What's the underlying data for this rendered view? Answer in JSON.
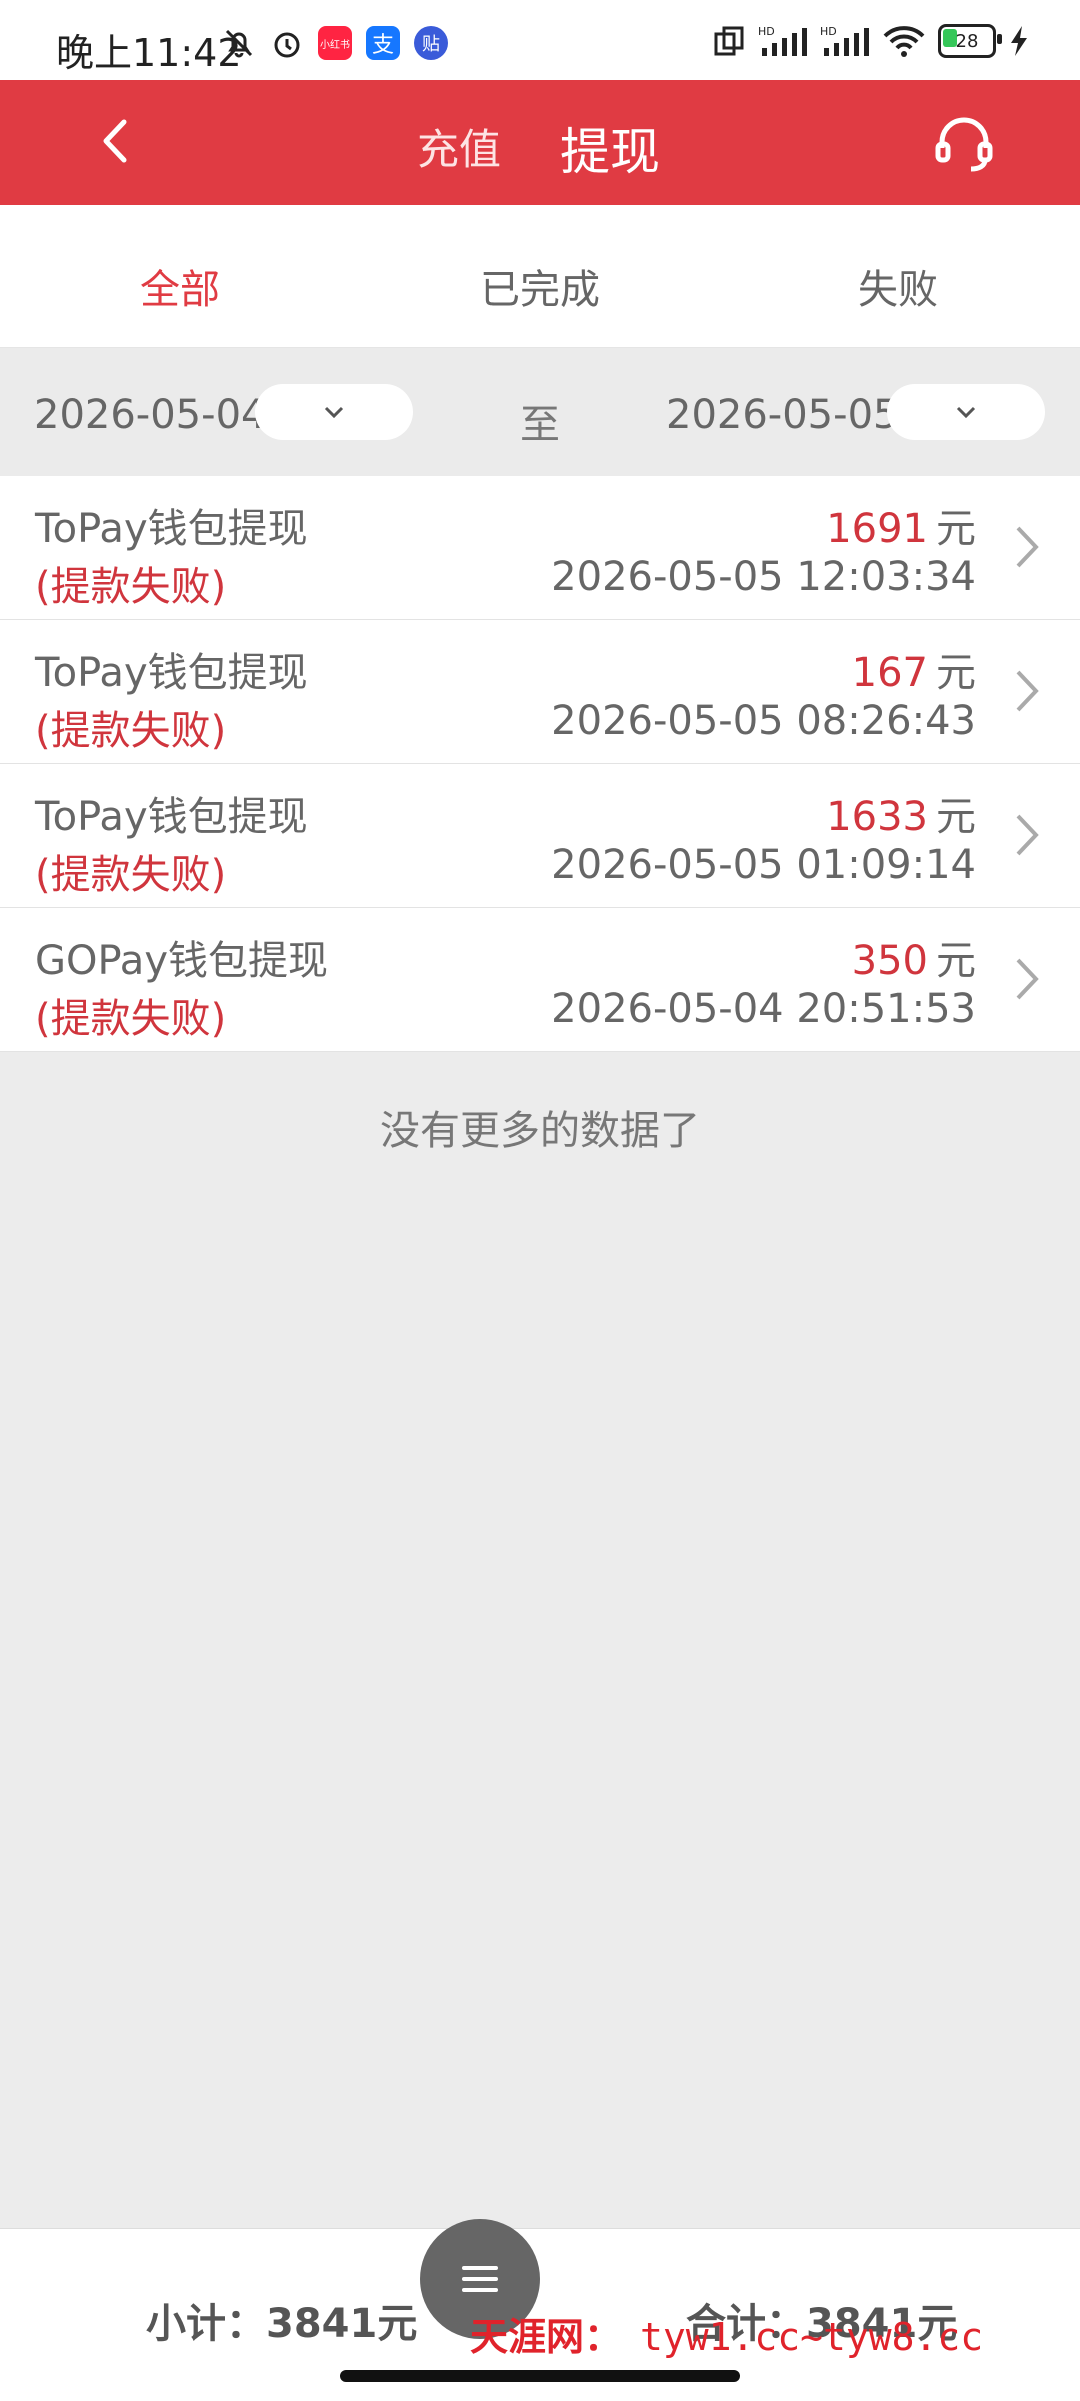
{
  "status_bar": {
    "time": "晚上11:42",
    "battery": "28",
    "app_badges": [
      {
        "label": "小红书",
        "color": "#ff2442"
      },
      {
        "label": "支",
        "color": "#1677ff"
      },
      {
        "label": "贴",
        "color": "#3a5bd9"
      }
    ]
  },
  "header": {
    "tab_recharge": "充值",
    "tab_withdraw": "提现"
  },
  "filter_tabs": [
    {
      "label": "全部",
      "active": true
    },
    {
      "label": "已完成",
      "active": false
    },
    {
      "label": "失败",
      "active": false
    }
  ],
  "date_filter": {
    "start": "2026-05-04",
    "separator": "至",
    "end": "2026-05-05"
  },
  "records": [
    {
      "title": "ToPay钱包提现",
      "status": "(提款失败)",
      "amount": "1691",
      "unit": "元",
      "time": "2026-05-05 12:03:34"
    },
    {
      "title": "ToPay钱包提现",
      "status": "(提款失败)",
      "amount": "167",
      "unit": "元",
      "time": "2026-05-05 08:26:43"
    },
    {
      "title": "ToPay钱包提现",
      "status": "(提款失败)",
      "amount": "1633",
      "unit": "元",
      "time": "2026-05-05 01:09:14"
    },
    {
      "title": "GOPay钱包提现",
      "status": "(提款失败)",
      "amount": "350",
      "unit": "元",
      "time": "2026-05-04 20:51:53"
    }
  ],
  "no_more": "没有更多的数据了",
  "footer": {
    "subtotal": "小计：3841元",
    "total": "合计：3841元"
  },
  "watermark": {
    "brand": "天涯网：",
    "domain": "tyw1.cc~tyw8.cc"
  },
  "colors": {
    "accent": "#e03b43",
    "status_fail": "#d0353d"
  }
}
